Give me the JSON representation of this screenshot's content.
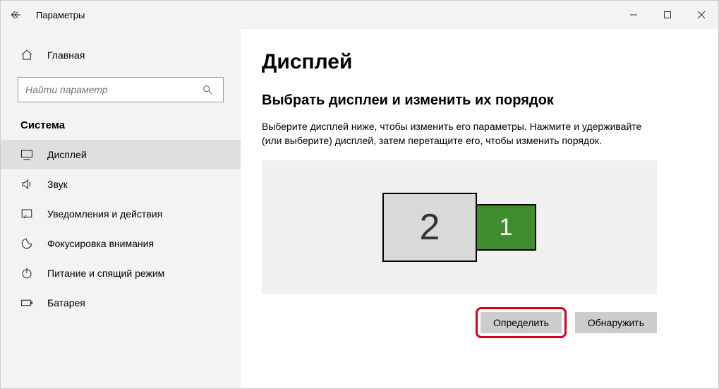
{
  "titlebar": {
    "title": "Параметры"
  },
  "sidebar": {
    "home": "Главная",
    "search_placeholder": "Найти параметр",
    "section": "Система",
    "items": [
      {
        "label": "Дисплей"
      },
      {
        "label": "Звук"
      },
      {
        "label": "Уведомления и действия"
      },
      {
        "label": "Фокусировка внимания"
      },
      {
        "label": "Питание и спящий режим"
      },
      {
        "label": "Батарея"
      }
    ]
  },
  "content": {
    "heading": "Дисплей",
    "subheading": "Выбрать дисплеи и изменить их порядок",
    "description": "Выберите дисплей ниже, чтобы изменить его параметры. Нажмите и удерживайте (или выберите) дисплей, затем перетащите его, чтобы изменить порядок.",
    "monitors": {
      "m1": "1",
      "m2": "2"
    },
    "identify_button": "Определить",
    "detect_button": "Обнаружить"
  }
}
